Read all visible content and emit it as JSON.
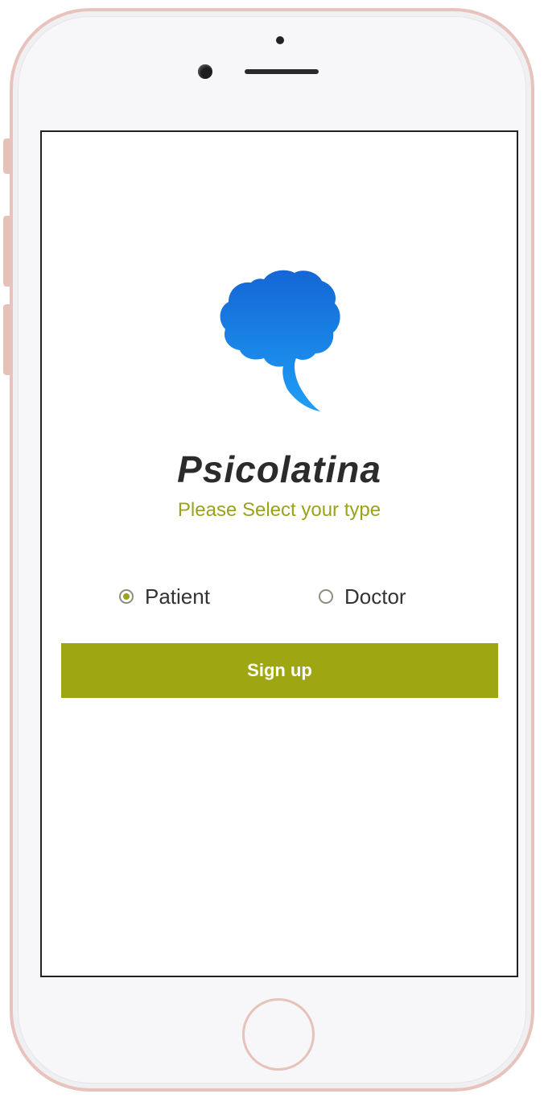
{
  "app": {
    "name": "Psicolatina",
    "subtitle": "Please Select your type",
    "logo_icon": "brain-speech-bubble-icon"
  },
  "user_type": {
    "options": [
      {
        "label": "Patient",
        "selected": true
      },
      {
        "label": "Doctor",
        "selected": false
      }
    ]
  },
  "actions": {
    "signup_label": "Sign up"
  },
  "colors": {
    "accent": "#9ea611",
    "logo_blue": "#1a7fe0",
    "title": "#2b2b2b"
  }
}
